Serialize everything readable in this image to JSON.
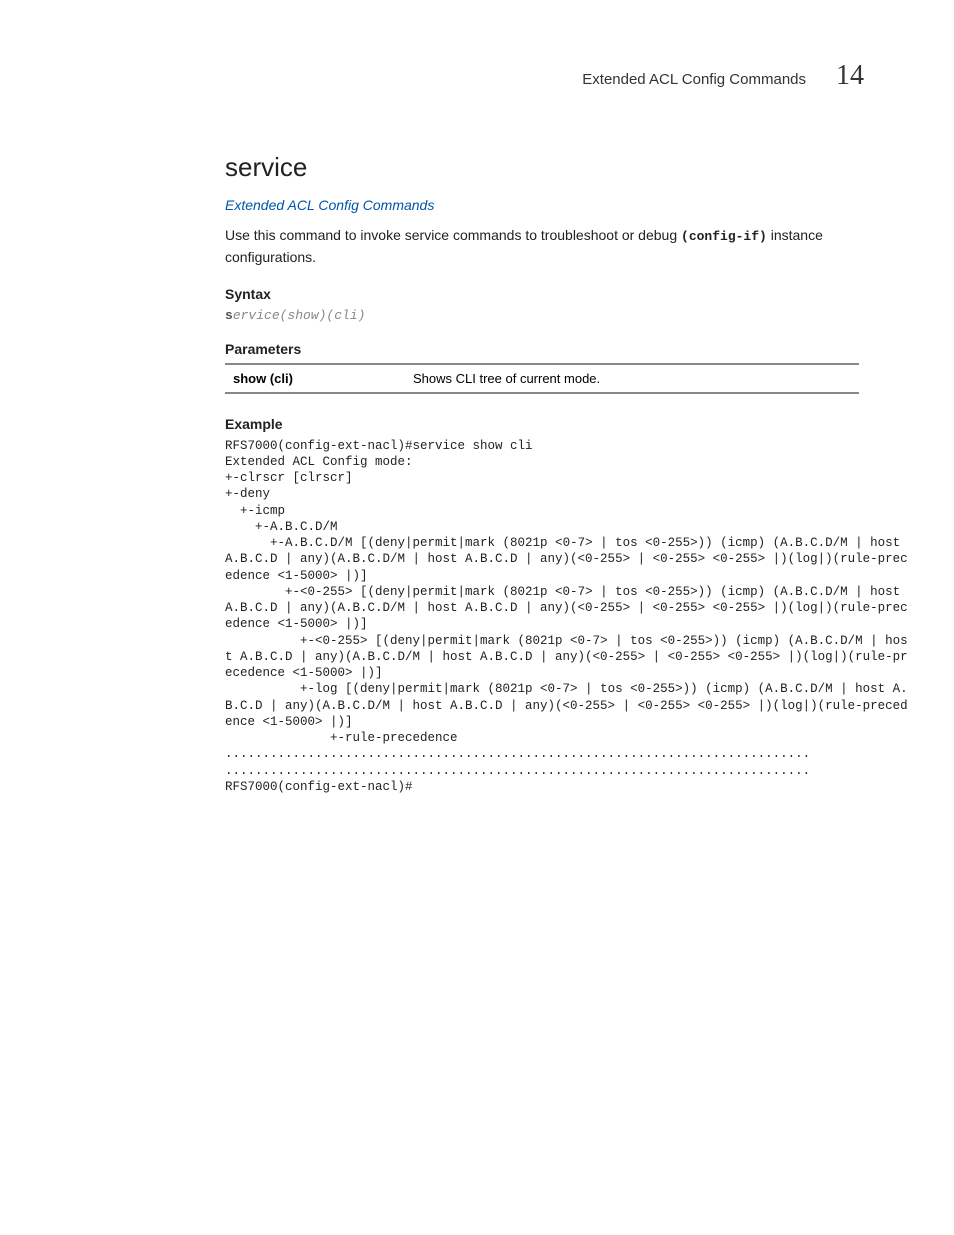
{
  "header": {
    "title": "Extended ACL Config Commands",
    "chapter": "14"
  },
  "section": {
    "title": "service",
    "link": "Extended ACL Config Commands",
    "description_pre": "Use this command to invoke service commands to troubleshoot or debug ",
    "description_code": "(config-if)",
    "description_post": " instance configurations."
  },
  "syntax": {
    "heading": "Syntax",
    "code": "service(show)(cli)"
  },
  "parameters": {
    "heading": "Parameters",
    "rows": [
      {
        "param": "show (cli)",
        "desc": "Shows CLI tree of current mode."
      }
    ]
  },
  "example": {
    "heading": "Example",
    "code": "RFS7000(config-ext-nacl)#service show cli\nExtended ACL Config mode:\n+-clrscr [clrscr]\n+-deny\n  +-icmp\n    +-A.B.C.D/M\n      +-A.B.C.D/M [(deny|permit|mark (8021p <0-7> | tos <0-255>)) (icmp) (A.B.C.D/M | host A.B.C.D | any)(A.B.C.D/M | host A.B.C.D | any)(<0-255> | <0-255> <0-255> |)(log|)(rule-precedence <1-5000> |)]\n        +-<0-255> [(deny|permit|mark (8021p <0-7> | tos <0-255>)) (icmp) (A.B.C.D/M | host A.B.C.D | any)(A.B.C.D/M | host A.B.C.D | any)(<0-255> | <0-255> <0-255> |)(log|)(rule-precedence <1-5000> |)]\n          +-<0-255> [(deny|permit|mark (8021p <0-7> | tos <0-255>)) (icmp) (A.B.C.D/M | host A.B.C.D | any)(A.B.C.D/M | host A.B.C.D | any)(<0-255> | <0-255> <0-255> |)(log|)(rule-precedence <1-5000> |)]\n          +-log [(deny|permit|mark (8021p <0-7> | tos <0-255>)) (icmp) (A.B.C.D/M | host A.B.C.D | any)(A.B.C.D/M | host A.B.C.D | any)(<0-255> | <0-255> <0-255> |)(log|)(rule-precedence <1-5000> |)]\n              +-rule-precedence\n..............................................................................\n..............................................................................\nRFS7000(config-ext-nacl)#"
  }
}
